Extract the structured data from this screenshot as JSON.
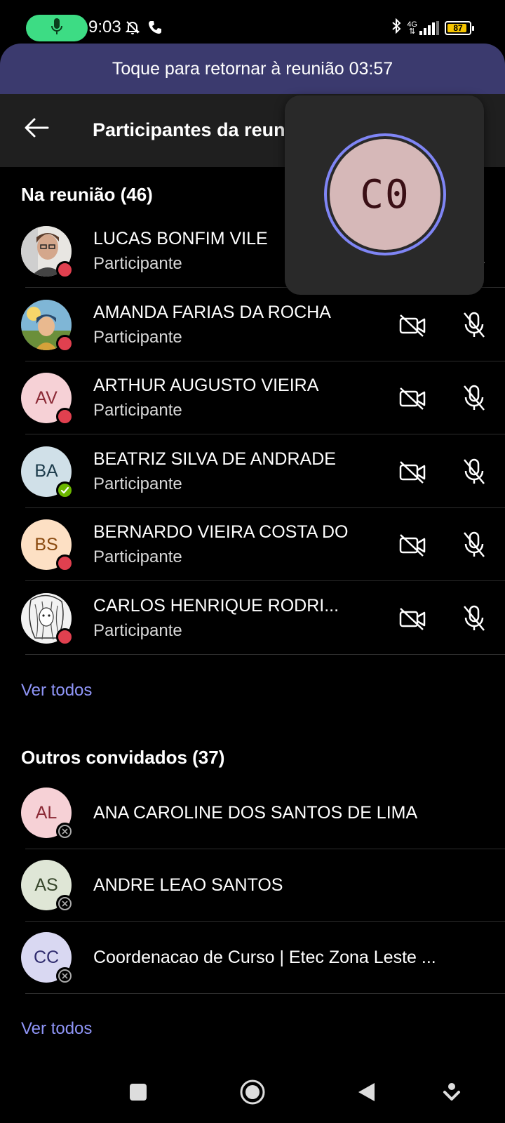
{
  "status_bar": {
    "time": "9:03",
    "network": "4G",
    "battery": "87",
    "battery_level": 0.87,
    "mic_icon": "microphone-icon",
    "icons": [
      "bell-off-icon",
      "phone-icon",
      "bluetooth-icon",
      "signal-icon",
      "battery-icon"
    ]
  },
  "banner": {
    "text": "Toque para retornar à reunião 03:57"
  },
  "header": {
    "title": "Participantes da reunião",
    "back_icon": "arrow-left-icon"
  },
  "video_tile": {
    "initials": "C0",
    "ring_color": "#7f85f5"
  },
  "in_meeting": {
    "title": "Na reunião (46)",
    "participants": [
      {
        "name": "LUCAS BONFIM VILE",
        "role": "Participante",
        "avatar": "photo",
        "presence": "busy"
      },
      {
        "name": "AMANDA FARIAS DA ROCHA",
        "role": "Participante",
        "avatar": "photo",
        "presence": "busy"
      },
      {
        "name": "ARTHUR AUGUSTO VIEIRA",
        "role": "Participante",
        "initials": "AV",
        "presence": "busy"
      },
      {
        "name": "BEATRIZ SILVA DE ANDRADE",
        "role": "Participante",
        "initials": "BA",
        "presence": "available"
      },
      {
        "name": "BERNARDO VIEIRA COSTA DO",
        "role": "Participante",
        "initials": "BS",
        "presence": "busy"
      },
      {
        "name": "CARLOS HENRIQUE RODRI...",
        "role": "Participante",
        "avatar": "photo",
        "presence": "busy"
      }
    ],
    "see_all": "Ver todos"
  },
  "others": {
    "title": "Outros convidados (37)",
    "invitees": [
      {
        "name": "ANA CAROLINE DOS SANTOS DE LIMA",
        "initials": "AL",
        "presence": "offline"
      },
      {
        "name": "ANDRE LEAO SANTOS",
        "initials": "AS",
        "presence": "offline"
      },
      {
        "name": "Coordenacao de Curso | Etec Zona Leste ...",
        "initials": "CC",
        "presence": "offline"
      }
    ],
    "see_all": "Ver todos"
  },
  "colors": {
    "accent": "#8f95f7",
    "banner": "#3b3a6e",
    "busy": "#e0404f",
    "available": "#6bb700",
    "avatar_av": "#f6d1d6",
    "avatar_ba": "#d0e0e8",
    "avatar_bs": "#fde0c4",
    "avatar_al": "#f6d1d6",
    "avatar_as": "#dfe6d6",
    "avatar_cc": "#d9d8f2"
  }
}
